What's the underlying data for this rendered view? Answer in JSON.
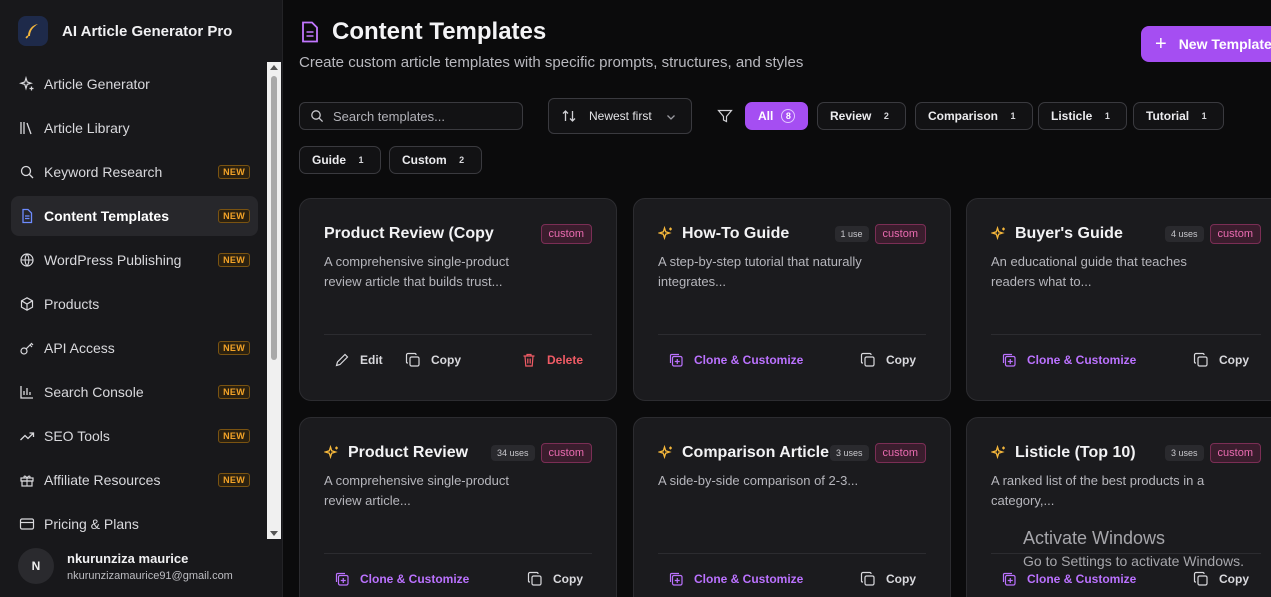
{
  "app": {
    "title": "AI Article Generator Pro",
    "logo_icon": "feather-pen-icon"
  },
  "sidebar": {
    "items": [
      {
        "label": "Article Generator",
        "icon": "sparkles-icon",
        "new": false,
        "active": false
      },
      {
        "label": "Article Library",
        "icon": "library-icon",
        "new": false,
        "active": false
      },
      {
        "label": "Keyword Research",
        "icon": "search-icon",
        "new": true,
        "active": false
      },
      {
        "label": "Content Templates",
        "icon": "document-icon",
        "new": true,
        "active": true
      },
      {
        "label": "WordPress Publishing",
        "icon": "globe-icon",
        "new": true,
        "active": false
      },
      {
        "label": "Products",
        "icon": "box-icon",
        "new": false,
        "active": false
      },
      {
        "label": "API Access",
        "icon": "key-icon",
        "new": true,
        "active": false
      },
      {
        "label": "Search Console",
        "icon": "bar-chart-icon",
        "new": true,
        "active": false
      },
      {
        "label": "SEO Tools",
        "icon": "trending-up-icon",
        "new": true,
        "active": false
      },
      {
        "label": "Affiliate Resources",
        "icon": "gift-icon",
        "new": true,
        "active": false
      },
      {
        "label": "Pricing & Plans",
        "icon": "credit-card-icon",
        "new": false,
        "active": false
      }
    ],
    "new_badge": "NEW",
    "user": {
      "initial": "N",
      "name": "nkurunziza maurice",
      "email": "nkurunzizamaurice91@gmail.com"
    }
  },
  "header": {
    "title": "Content Templates",
    "subtitle": "Create custom article templates with specific prompts, structures, and styles",
    "new_button": "New Template"
  },
  "toolbar": {
    "search_placeholder": "Search templates...",
    "sort_label": "Newest first",
    "filters": [
      {
        "label": "All",
        "count": "8",
        "active": true
      },
      {
        "label": "Review",
        "count": "2",
        "active": false
      },
      {
        "label": "Comparison",
        "count": "1",
        "active": false
      },
      {
        "label": "Listicle",
        "count": "1",
        "active": false
      },
      {
        "label": "Tutorial",
        "count": "1",
        "active": false
      },
      {
        "label": "Guide",
        "count": "1",
        "active": false
      },
      {
        "label": "Custom",
        "count": "2",
        "active": false
      }
    ]
  },
  "cards": [
    {
      "title": "Product Review (Copy",
      "uses": "",
      "tag": "custom",
      "desc": "A comprehensive single-product review article that builds trust...",
      "actions": [
        "Edit",
        "Copy",
        "Delete"
      ]
    },
    {
      "title": "How-To Guide",
      "uses": "1 use",
      "tag": "custom",
      "desc": "A step-by-step tutorial that naturally integrates...",
      "actions": [
        "Clone & Customize",
        "Copy"
      ]
    },
    {
      "title": "Buyer's Guide",
      "uses": "4 uses",
      "tag": "custom",
      "desc": "An educational guide that teaches readers what to...",
      "actions": [
        "Clone & Customize",
        "Copy"
      ]
    },
    {
      "title": "Product Review",
      "uses": "34 uses",
      "tag": "custom",
      "desc": "A comprehensive single-product review article...",
      "actions": [
        "Clone & Customize",
        "Copy"
      ]
    },
    {
      "title": "Comparison Article",
      "uses": "3 uses",
      "tag": "custom",
      "desc": "A side-by-side comparison of 2-3...",
      "actions": [
        "Clone & Customize",
        "Copy"
      ]
    },
    {
      "title": "Listicle (Top 10)",
      "uses": "3 uses",
      "tag": "custom",
      "desc": "A ranked list of the best products in a category,...",
      "actions": [
        "Clone & Customize",
        "Copy"
      ]
    }
  ],
  "watermark": {
    "title": "Activate Windows",
    "subtitle": "Go to Settings to activate Windows."
  },
  "colors": {
    "accent": "#a54ef2",
    "tag_custom": "#ea6bb0",
    "badge_new": "#f3a328",
    "delete": "#f05b65",
    "sparkle": "#f5b73b"
  }
}
